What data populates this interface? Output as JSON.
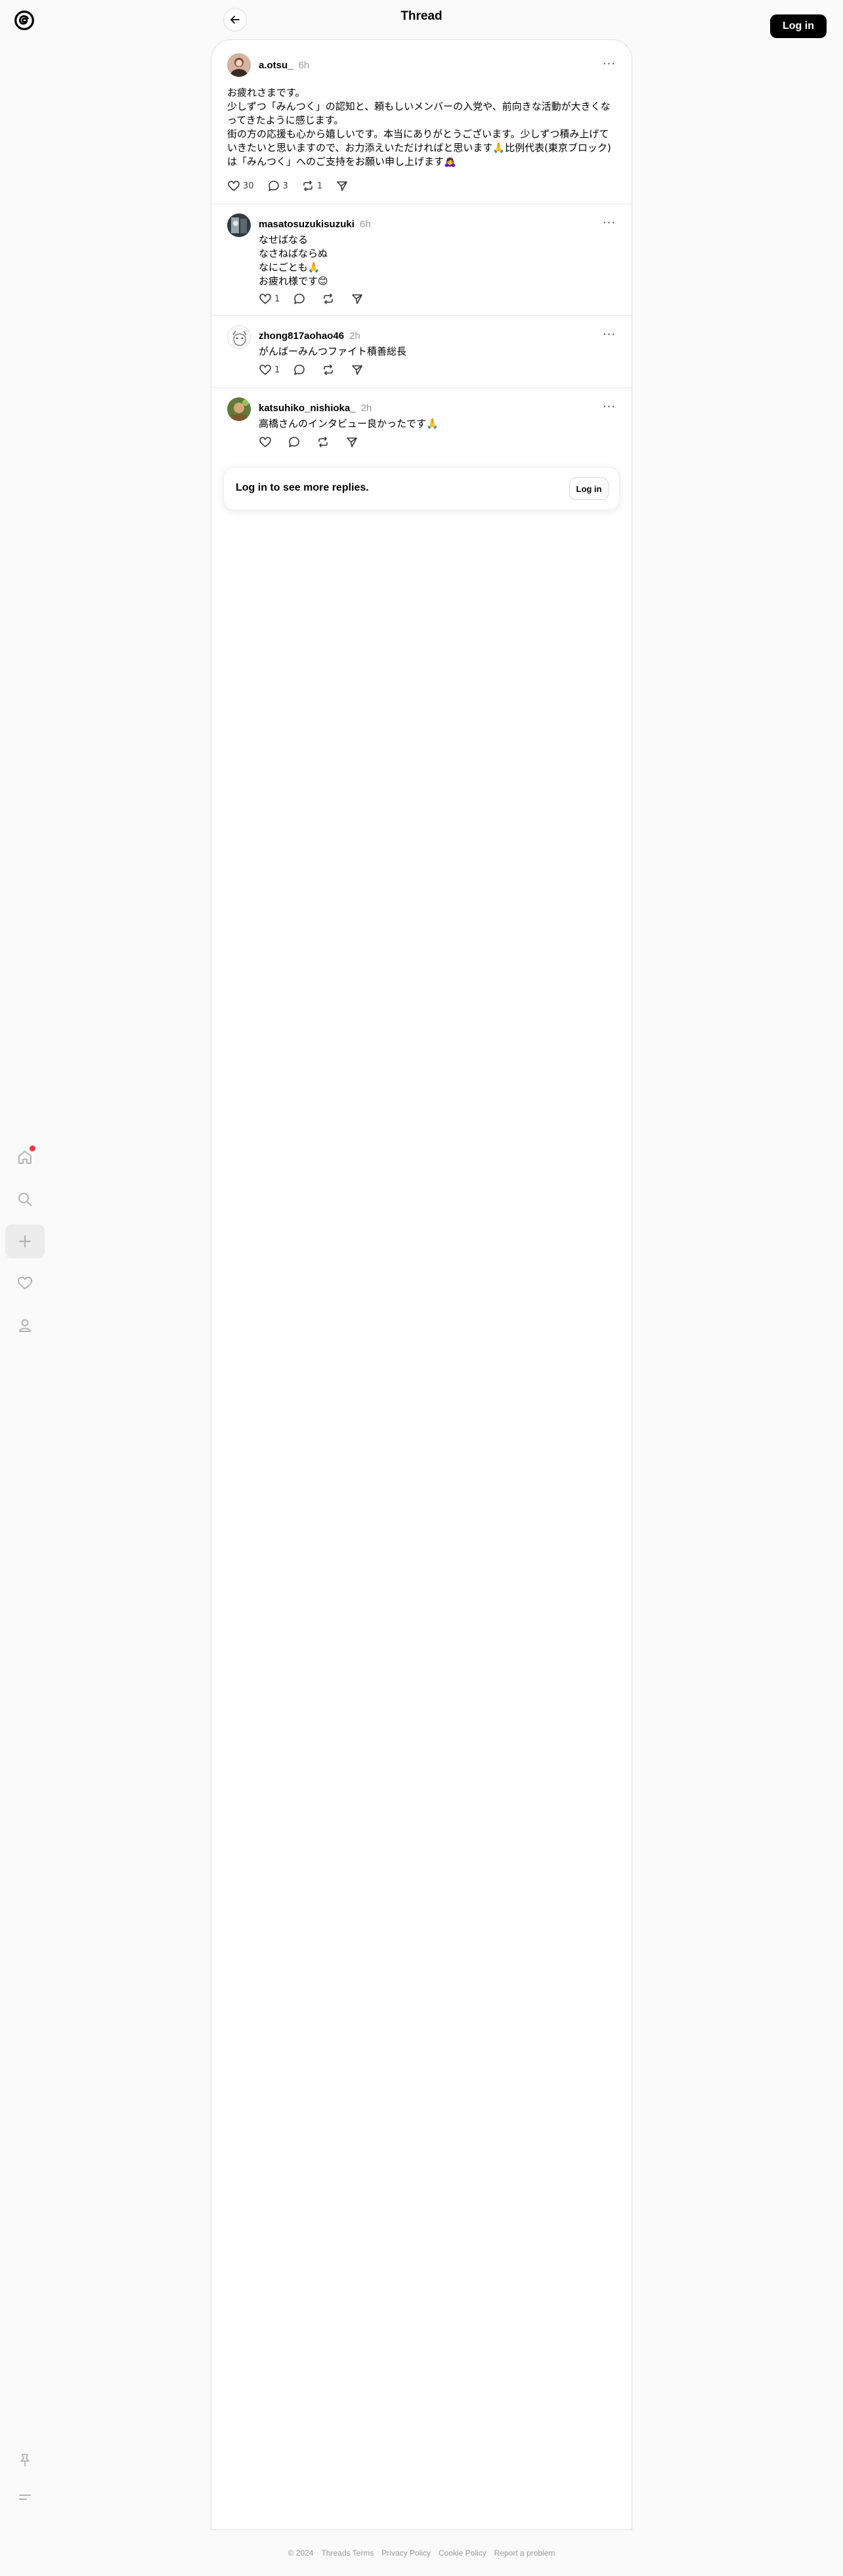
{
  "header": {
    "title": "Thread",
    "login_label": "Log in"
  },
  "nav": {
    "items": [
      {
        "name": "home",
        "icon": "home-icon",
        "has_notification": true
      },
      {
        "name": "search",
        "icon": "search-icon"
      },
      {
        "name": "create",
        "icon": "plus-icon",
        "active": true
      },
      {
        "name": "activity",
        "icon": "heart-icon"
      },
      {
        "name": "profile",
        "icon": "person-icon"
      }
    ],
    "bottom": [
      {
        "name": "pin",
        "icon": "pin-icon"
      },
      {
        "name": "menu",
        "icon": "menu-icon"
      }
    ]
  },
  "posts": [
    {
      "username": "a.otsu_",
      "time": "6h",
      "text": "お疲れさまです。\n少しずつ「みんつく」の認知と、頼もしいメンバーの入党や、前向きな活動が大きくなってきたように感じます。\n街の方の応援も心から嬉しいです。本当にありがとうございます。少しずつ積み上げていきたいと思いますので、お力添えいただければと思います🙏比例代表(東京ブロック)は「みんつく」へのご支持をお願い申し上げます🙇‍♀️",
      "likes": "30",
      "replies": "3",
      "reposts": "1"
    },
    {
      "username": "masatosuzukisuzuki",
      "time": "6h",
      "text": "なせばなる\nなさねばならぬ\nなにごとも🙏\nお疲れ様です😊",
      "likes": "1",
      "replies": "",
      "reposts": ""
    },
    {
      "username": "zhong817aohao46",
      "time": "2h",
      "text": "がんばーみんつファイト積善総長",
      "likes": "1",
      "replies": "",
      "reposts": ""
    },
    {
      "username": "katsuhiko_nishioka_",
      "time": "2h",
      "text": "高橋さんのインタビュー良かったです🙏",
      "likes": "",
      "replies": "",
      "reposts": ""
    }
  ],
  "login_prompt": {
    "text": "Log in to see more replies.",
    "button": "Log in"
  },
  "footer": {
    "copyright": "© 2024",
    "links": [
      "Threads Terms",
      "Privacy Policy",
      "Cookie Policy",
      "Report a problem"
    ]
  },
  "colors": {
    "accent_dot": "#ff3040",
    "button_bg": "#000000"
  }
}
